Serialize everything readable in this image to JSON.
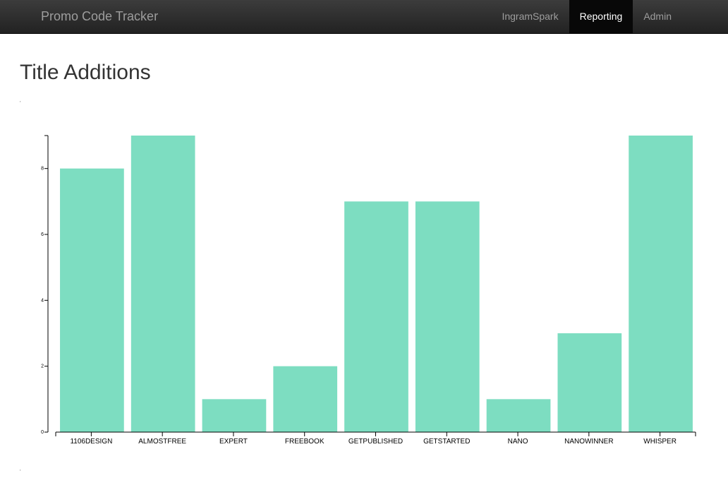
{
  "navbar": {
    "brand": "Promo Code Tracker",
    "items": [
      {
        "label": "IngramSpark",
        "active": false
      },
      {
        "label": "Reporting",
        "active": true
      },
      {
        "label": "Admin",
        "active": false
      }
    ]
  },
  "page": {
    "title": "Title Additions",
    "top_mark": ",",
    "bottom_mark": ","
  },
  "colors": {
    "bar": "#7dddc1",
    "navbar": "#222222"
  },
  "chart_data": {
    "type": "bar",
    "categories": [
      "1106DESIGN",
      "ALMOSTFREE",
      "EXPERT",
      "FREEBOOK",
      "GETPUBLISHED",
      "GETSTARTED",
      "NANO",
      "NANOWINNER",
      "WHISPER"
    ],
    "values": [
      8,
      9,
      1,
      2,
      7,
      7,
      1,
      3,
      9
    ],
    "yticks": [
      0,
      2,
      4,
      6,
      8
    ],
    "ylim": [
      0,
      9
    ],
    "title": "",
    "xlabel": "",
    "ylabel": "",
    "grid": false
  }
}
